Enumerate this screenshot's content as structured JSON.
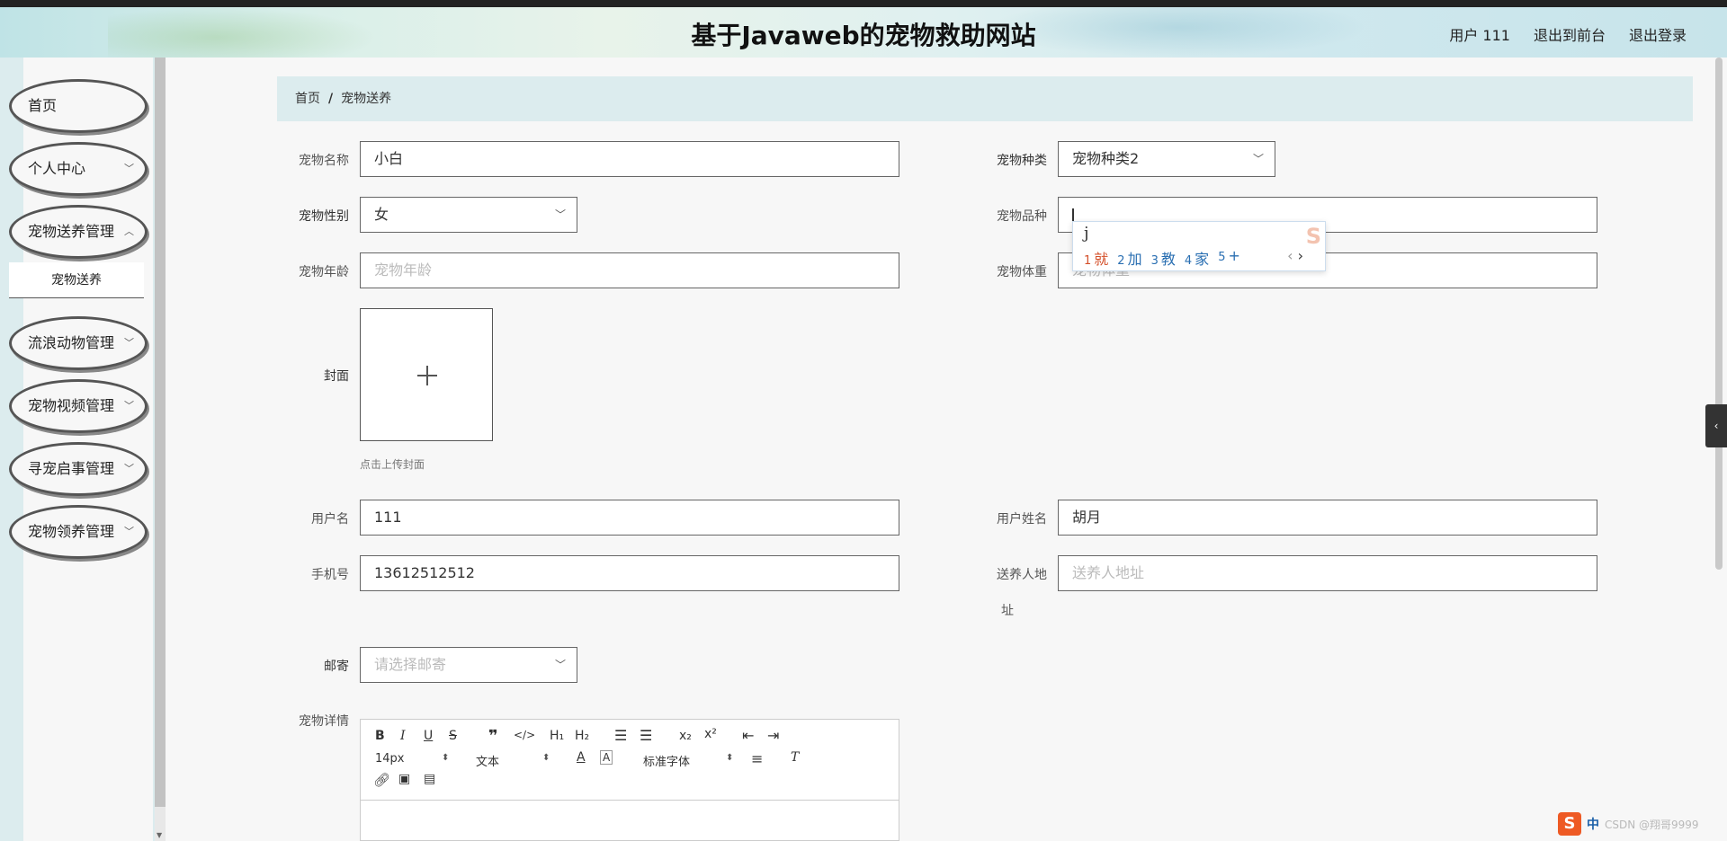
{
  "header": {
    "site_title": "基于Javaweb的宠物救助网站",
    "user_label": "用户 111",
    "to_front": "退出到前台",
    "logout": "退出登录"
  },
  "sidebar": {
    "items": [
      {
        "label": "首页",
        "has_arrow": false
      },
      {
        "label": "个人中心",
        "has_arrow": true
      },
      {
        "label": "宠物送养管理",
        "has_arrow": true
      },
      {
        "label": "流浪动物管理",
        "has_arrow": true
      },
      {
        "label": "宠物视频管理",
        "has_arrow": true
      },
      {
        "label": "寻宠启事管理",
        "has_arrow": true
      },
      {
        "label": "宠物领养管理",
        "has_arrow": true
      }
    ],
    "active_sub": "宠物送养"
  },
  "breadcrumb": {
    "home": "首页",
    "separator": "/",
    "current": "宠物送养"
  },
  "form": {
    "pet_name": {
      "label": "宠物名称",
      "value": "小白"
    },
    "pet_type": {
      "label": "宠物种类",
      "value": "宠物种类2"
    },
    "pet_gender": {
      "label": "宠物性别",
      "value": "女"
    },
    "pet_breed": {
      "label": "宠物品种",
      "value": "j"
    },
    "pet_age": {
      "label": "宠物年龄",
      "placeholder": "宠物年龄"
    },
    "pet_weight": {
      "label": "宠物体重",
      "placeholder": "宠物体重"
    },
    "cover": {
      "label": "封面",
      "tip": "点击上传封面"
    },
    "username": {
      "label": "用户名",
      "value": "111"
    },
    "real_name": {
      "label": "用户姓名",
      "value": "胡月"
    },
    "phone": {
      "label": "手机号",
      "value": "13612512512"
    },
    "address": {
      "label_line1": "送养人地",
      "label_line2": "址",
      "placeholder": "送养人地址"
    },
    "mail": {
      "label": "邮寄",
      "placeholder": "请选择邮寄"
    },
    "details": {
      "label": "宠物详情"
    }
  },
  "editor": {
    "font_size": "14px",
    "text_type": "文本",
    "font_family": "标准字体"
  },
  "ime": {
    "typed": "j",
    "candidates": [
      {
        "n": "1",
        "text": "就"
      },
      {
        "n": "2",
        "text": "加"
      },
      {
        "n": "3",
        "text": "教"
      },
      {
        "n": "4",
        "text": "家"
      },
      {
        "n": "5",
        "text": "+"
      }
    ]
  },
  "tray": {
    "logo": "S",
    "ime_mode": "中",
    "watermark": "CSDN @翔哥9999"
  },
  "colors": {
    "breadcrumb_bg": "#dcecee",
    "sidebar_bg": "#dcecee",
    "accent_orange": "#ee5a24"
  }
}
